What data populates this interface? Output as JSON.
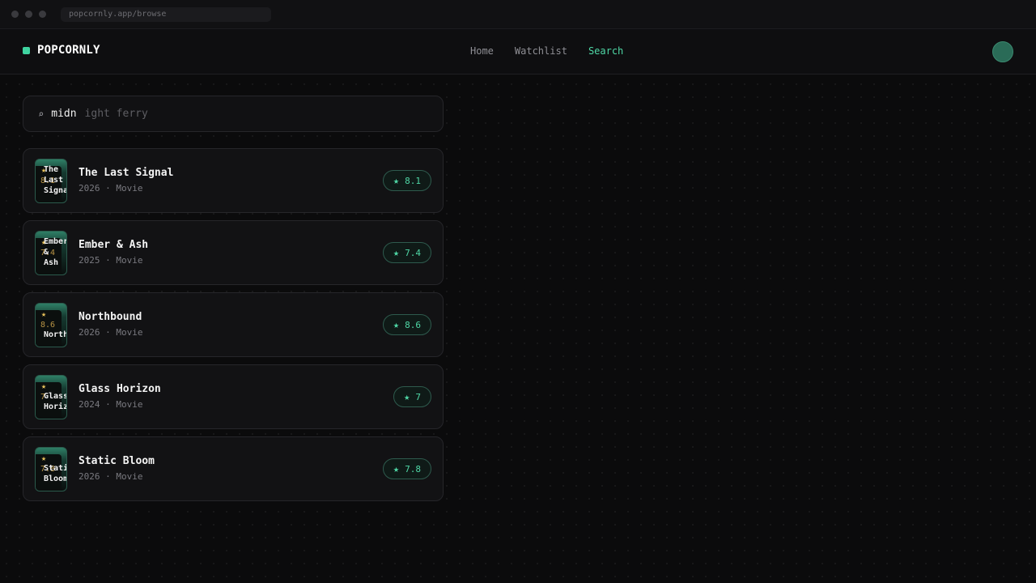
{
  "browser": {
    "url": "popcornly.app/browse"
  },
  "brand": {
    "name": "POPCORNLY"
  },
  "nav": [
    {
      "label": "Home",
      "active": false
    },
    {
      "label": "Watchlist",
      "active": false
    },
    {
      "label": "Search",
      "active": true
    }
  ],
  "search": {
    "typed": "midn",
    "suggestion": "ight ferry"
  },
  "results": [
    {
      "poster_title": "The\nLast\nSignal",
      "poster_score": "8.1",
      "title": "The Last Signal",
      "meta": "2026 · Movie",
      "rating": "8.1"
    },
    {
      "poster_title": "Ember\n&\nAsh",
      "poster_score": "7.4",
      "title": "Ember & Ash",
      "meta": "2025 · Movie",
      "rating": "7.4"
    },
    {
      "poster_title": "\n\nNorthbound",
      "poster_score": "8.6",
      "title": "Northbound",
      "meta": "2026 · Movie",
      "rating": "8.6"
    },
    {
      "poster_title": "\nGlass\nHorizon",
      "poster_score": "7",
      "title": "Glass Horizon",
      "meta": "2024 · Movie",
      "rating": "7"
    },
    {
      "poster_title": "\nStatic\nBloom",
      "poster_score": "7.8",
      "title": "Static Bloom",
      "meta": "2026 · Movie",
      "rating": "7.8"
    }
  ],
  "icons": {
    "search": "search-icon",
    "star": "star-icon"
  },
  "colors": {
    "accent": "#4fd8a6",
    "brand_dot": "#3fd3a0",
    "poster_star": "#e9c35b"
  }
}
